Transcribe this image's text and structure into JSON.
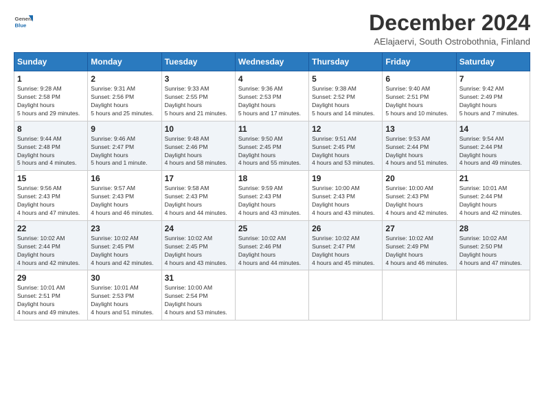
{
  "logo": {
    "general": "General",
    "blue": "Blue"
  },
  "title": "December 2024",
  "subtitle": "AElajaervi, South Ostrobothnia, Finland",
  "days_header": [
    "Sunday",
    "Monday",
    "Tuesday",
    "Wednesday",
    "Thursday",
    "Friday",
    "Saturday"
  ],
  "weeks": [
    [
      {
        "day": "1",
        "sunrise": "9:28 AM",
        "sunset": "2:58 PM",
        "daylight": "5 hours and 29 minutes."
      },
      {
        "day": "2",
        "sunrise": "9:31 AM",
        "sunset": "2:56 PM",
        "daylight": "5 hours and 25 minutes."
      },
      {
        "day": "3",
        "sunrise": "9:33 AM",
        "sunset": "2:55 PM",
        "daylight": "5 hours and 21 minutes."
      },
      {
        "day": "4",
        "sunrise": "9:36 AM",
        "sunset": "2:53 PM",
        "daylight": "5 hours and 17 minutes."
      },
      {
        "day": "5",
        "sunrise": "9:38 AM",
        "sunset": "2:52 PM",
        "daylight": "5 hours and 14 minutes."
      },
      {
        "day": "6",
        "sunrise": "9:40 AM",
        "sunset": "2:51 PM",
        "daylight": "5 hours and 10 minutes."
      },
      {
        "day": "7",
        "sunrise": "9:42 AM",
        "sunset": "2:49 PM",
        "daylight": "5 hours and 7 minutes."
      }
    ],
    [
      {
        "day": "8",
        "sunrise": "9:44 AM",
        "sunset": "2:48 PM",
        "daylight": "5 hours and 4 minutes."
      },
      {
        "day": "9",
        "sunrise": "9:46 AM",
        "sunset": "2:47 PM",
        "daylight": "5 hours and 1 minute."
      },
      {
        "day": "10",
        "sunrise": "9:48 AM",
        "sunset": "2:46 PM",
        "daylight": "4 hours and 58 minutes."
      },
      {
        "day": "11",
        "sunrise": "9:50 AM",
        "sunset": "2:45 PM",
        "daylight": "4 hours and 55 minutes."
      },
      {
        "day": "12",
        "sunrise": "9:51 AM",
        "sunset": "2:45 PM",
        "daylight": "4 hours and 53 minutes."
      },
      {
        "day": "13",
        "sunrise": "9:53 AM",
        "sunset": "2:44 PM",
        "daylight": "4 hours and 51 minutes."
      },
      {
        "day": "14",
        "sunrise": "9:54 AM",
        "sunset": "2:44 PM",
        "daylight": "4 hours and 49 minutes."
      }
    ],
    [
      {
        "day": "15",
        "sunrise": "9:56 AM",
        "sunset": "2:43 PM",
        "daylight": "4 hours and 47 minutes."
      },
      {
        "day": "16",
        "sunrise": "9:57 AM",
        "sunset": "2:43 PM",
        "daylight": "4 hours and 46 minutes."
      },
      {
        "day": "17",
        "sunrise": "9:58 AM",
        "sunset": "2:43 PM",
        "daylight": "4 hours and 44 minutes."
      },
      {
        "day": "18",
        "sunrise": "9:59 AM",
        "sunset": "2:43 PM",
        "daylight": "4 hours and 43 minutes."
      },
      {
        "day": "19",
        "sunrise": "10:00 AM",
        "sunset": "2:43 PM",
        "daylight": "4 hours and 43 minutes."
      },
      {
        "day": "20",
        "sunrise": "10:00 AM",
        "sunset": "2:43 PM",
        "daylight": "4 hours and 42 minutes."
      },
      {
        "day": "21",
        "sunrise": "10:01 AM",
        "sunset": "2:44 PM",
        "daylight": "4 hours and 42 minutes."
      }
    ],
    [
      {
        "day": "22",
        "sunrise": "10:02 AM",
        "sunset": "2:44 PM",
        "daylight": "4 hours and 42 minutes."
      },
      {
        "day": "23",
        "sunrise": "10:02 AM",
        "sunset": "2:45 PM",
        "daylight": "4 hours and 42 minutes."
      },
      {
        "day": "24",
        "sunrise": "10:02 AM",
        "sunset": "2:45 PM",
        "daylight": "4 hours and 43 minutes."
      },
      {
        "day": "25",
        "sunrise": "10:02 AM",
        "sunset": "2:46 PM",
        "daylight": "4 hours and 44 minutes."
      },
      {
        "day": "26",
        "sunrise": "10:02 AM",
        "sunset": "2:47 PM",
        "daylight": "4 hours and 45 minutes."
      },
      {
        "day": "27",
        "sunrise": "10:02 AM",
        "sunset": "2:49 PM",
        "daylight": "4 hours and 46 minutes."
      },
      {
        "day": "28",
        "sunrise": "10:02 AM",
        "sunset": "2:50 PM",
        "daylight": "4 hours and 47 minutes."
      }
    ],
    [
      {
        "day": "29",
        "sunrise": "10:01 AM",
        "sunset": "2:51 PM",
        "daylight": "4 hours and 49 minutes."
      },
      {
        "day": "30",
        "sunrise": "10:01 AM",
        "sunset": "2:53 PM",
        "daylight": "4 hours and 51 minutes."
      },
      {
        "day": "31",
        "sunrise": "10:00 AM",
        "sunset": "2:54 PM",
        "daylight": "4 hours and 53 minutes."
      },
      null,
      null,
      null,
      null
    ]
  ]
}
